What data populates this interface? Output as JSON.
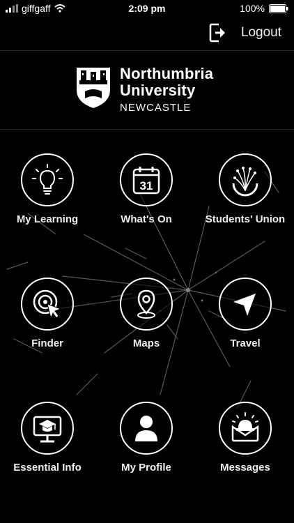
{
  "status_bar": {
    "carrier": "giffgaff",
    "time": "2:09 pm",
    "battery": "100%"
  },
  "top_bar": {
    "logout_label": "Logout",
    "logout_icon": "logout-icon"
  },
  "header": {
    "line1": "Northumbria",
    "line2": "University",
    "line3": "NEWCASTLE",
    "crest_icon": "university-crest-icon"
  },
  "tiles": [
    {
      "label": "My Learning",
      "icon": "lightbulb-icon"
    },
    {
      "label": "What's On",
      "icon": "calendar-icon",
      "icon_text": "31"
    },
    {
      "label": "Students' Union",
      "icon": "fireworks-icon"
    },
    {
      "label": "Finder",
      "icon": "target-pointer-icon"
    },
    {
      "label": "Maps",
      "icon": "location-pin-icon"
    },
    {
      "label": "Travel",
      "icon": "navigation-arrow-icon"
    },
    {
      "label": "Essential Info",
      "icon": "monitor-graduation-icon"
    },
    {
      "label": "My Profile",
      "icon": "person-icon"
    },
    {
      "label": "Messages",
      "icon": "notification-bell-icon"
    }
  ],
  "colors": {
    "background": "#000000",
    "foreground": "#ffffff"
  }
}
